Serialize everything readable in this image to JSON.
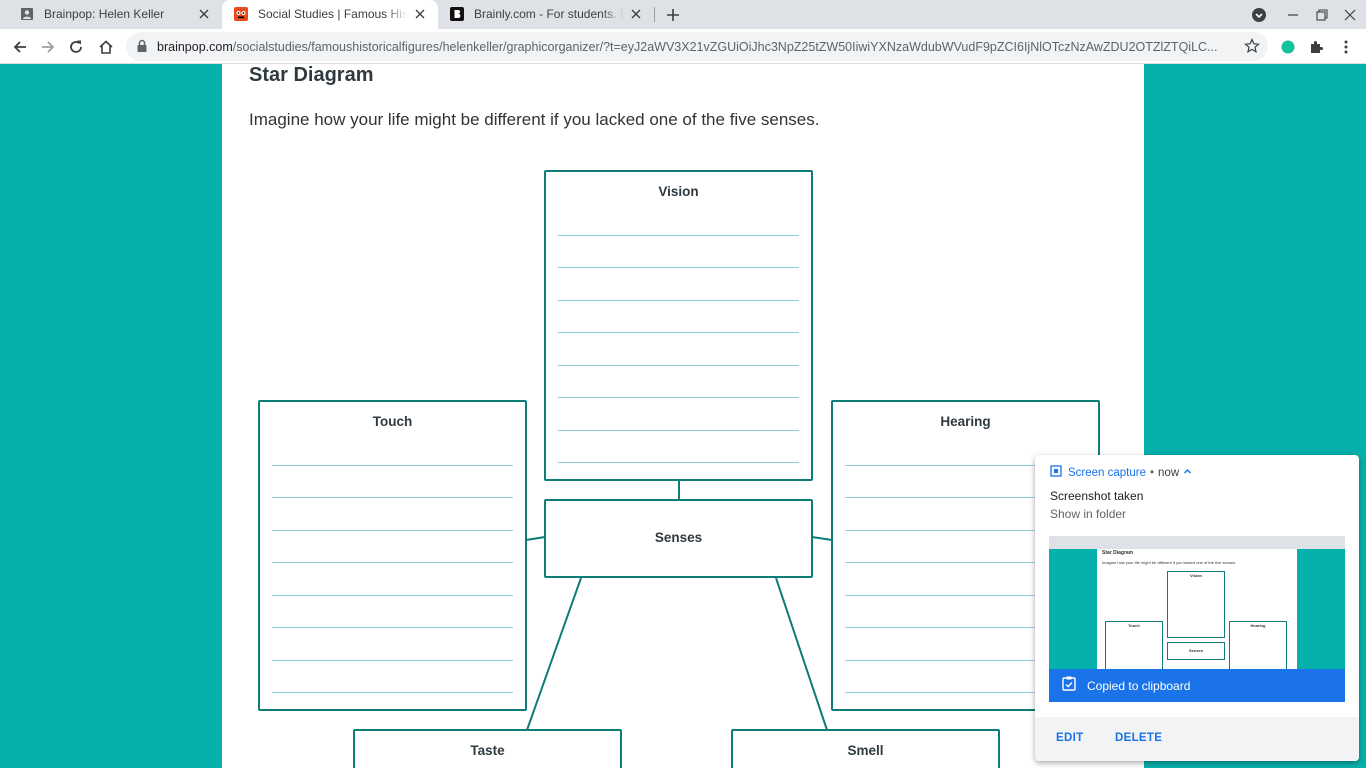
{
  "tabs": [
    {
      "title": "Brainpop: Helen Keller",
      "favicon": "person-icon",
      "active": false
    },
    {
      "title": "Social Studies | Famous Historical Figures",
      "favicon": "brainpop-icon",
      "active": true
    },
    {
      "title": "Brainly.com - For students. By students.",
      "favicon": "brainly-icon",
      "active": false
    }
  ],
  "address": {
    "domain": "brainpop.com",
    "path": "/socialstudies/famoushistoricalfigures/helenkeller/graphicorganizer/?t=eyJ2aWV3X21vZGUiOiJhc3NpZ25tZW50IiwiYXNzaWdubWVudF9pZCI6IjNlOTczNzAwZDU2OTZlZTQiLC..."
  },
  "page": {
    "title": "Star Diagram",
    "instructions": "Imagine how your life might be different if you lacked one of the five senses."
  },
  "diagram": {
    "center": "Senses",
    "vision": "Vision",
    "touch": "Touch",
    "hearing": "Hearing",
    "taste": "Taste",
    "smell": "Smell"
  },
  "notification": {
    "app": "Screen capture",
    "separator": "•",
    "time": "now",
    "title": "Screenshot taken",
    "subtitle": "Show in folder",
    "clipboard": "Copied to clipboard",
    "edit": "EDIT",
    "delete": "DELETE",
    "preview": {
      "title": "Star Diagram",
      "instructions": "Imagine how your life might be different if you lacked one of the five senses.",
      "vision": "Vision",
      "touch": "Touch",
      "hearing": "Hearing",
      "center": "Senses"
    }
  },
  "colors": {
    "teal_bg": "#06b0ab",
    "box_border": "#0e7c78",
    "rule": "#8fd0d6",
    "accent_blue": "#1a73e8"
  }
}
